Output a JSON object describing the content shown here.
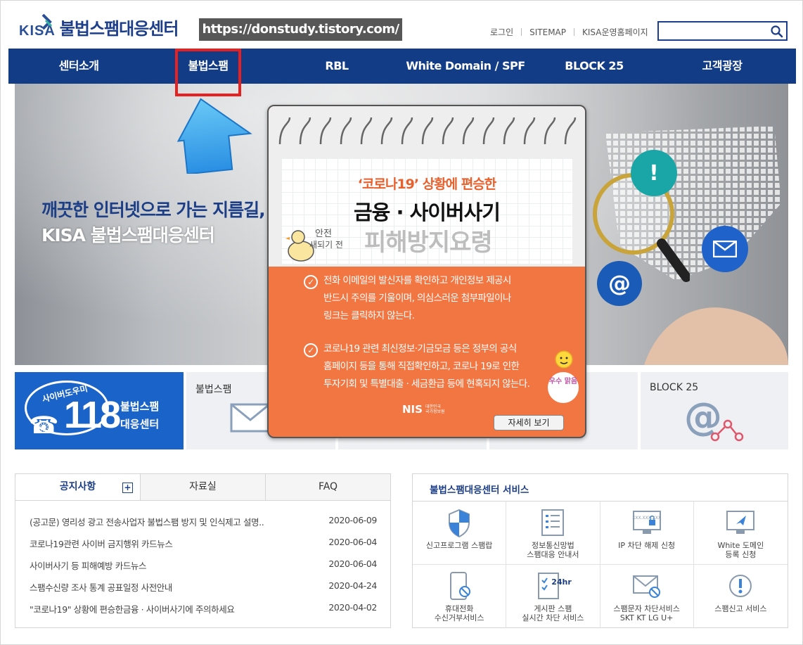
{
  "header": {
    "logo_mark": "KISA",
    "logo_title": "불법스팸대응센터",
    "url_banner": "https://donstudy.tistory.com/",
    "util_links": [
      "로그인",
      "SITEMAP",
      "KISA운영홈페이지"
    ],
    "search": {
      "value": "",
      "placeholder": ""
    }
  },
  "nav": {
    "items": [
      "센터소개",
      "불법스팸",
      "RBL",
      "White Domain / SPF",
      "BLOCK 25",
      "고객광장"
    ],
    "highlight_color": "#e8201f",
    "bar_color": "#133c86"
  },
  "hero": {
    "slogan_line1": "깨끗한 인터넷으로 가는 지름길,",
    "slogan_line2": "KISA 불법스팸대응센터"
  },
  "popup": {
    "subtitle": "‘코로나19’ 상황에 편승한",
    "headline": "금융 · 사이버사기",
    "headline2": "피해방지요령",
    "duck_text_1": "안전",
    "duck_text_2": "새되기 전",
    "items": [
      [
        "전화 이메일의 발신자를 확인하고 개인정보 제공시",
        "반드시 주의를 기울이며, 의심스러운 첨부파일이나",
        "링크는 클릭하지 않는다."
      ],
      [
        "코로나19 관련 최신정보·기금모금 등은 정부의 공식",
        "홈페이지 등을 통해 직접확인하고, 코로나 19로 인한",
        "투자기회 및 특별대출 · 세금환급 등에 현혹되지 않는다."
      ]
    ],
    "badge_text": "우수 맑음",
    "nis": "NIS",
    "nis_small_1": "대한민국",
    "nis_small_2": "국가정보원",
    "button": "자세히 보기",
    "accent": "#f17642"
  },
  "cards": {
    "card_118": {
      "tag": "사이버도우미",
      "number": "118",
      "line1": "불법스팸",
      "line2": "대응센터"
    },
    "titles": [
      "불법스팸",
      "",
      "",
      "BLOCK 25"
    ]
  },
  "notice": {
    "tabs": [
      "공지사항",
      "자료실",
      "FAQ"
    ],
    "plus": "+",
    "rows": [
      {
        "title": "(공고문) 영리성 광고 전송사업자 불법스팸 방지 및 인식제고 설명..",
        "date": "2020-06-09"
      },
      {
        "title": "코로나19관련 사이버 금지행위 카드뉴스",
        "date": "2020-06-04"
      },
      {
        "title": "사이버사기 등 피해예방 카드뉴스",
        "date": "2020-06-04"
      },
      {
        "title": "스팸수신량 조사 통계 공표일정 사전안내",
        "date": "2020-04-24"
      },
      {
        "title": "\"코로나19\" 상황에 편승한금융 · 사이버사기에 주의하세요",
        "date": "2020-04-02"
      }
    ]
  },
  "services": {
    "title": "불법스팸대응센터 서비스",
    "items": [
      {
        "label": "신고프로그램 스팸랍",
        "icon": "shield-icon"
      },
      {
        "label": "정보통신망법\n스팸대응 안내서",
        "icon": "document-list-icon"
      },
      {
        "label": "IP 차단 해제 신청",
        "icon": "ip-lock-icon"
      },
      {
        "label": "White 도메인\n등록 신청",
        "icon": "monitor-send-icon"
      },
      {
        "label": "휴대전화\n수신거부서비스",
        "icon": "phone-block-icon"
      },
      {
        "label": "게시판 스팸\n실시간 차단 서비스",
        "icon": "clipboard-24hr-icon"
      },
      {
        "label": "스팸문자 차단서비스\nSKT  KT  LG U+",
        "icon": "message-block-icon"
      },
      {
        "label": "스팸신고 서비스",
        "icon": "alert-icon"
      }
    ],
    "badge_24hr": "24hr",
    "ip_sample": "XXX.XXX.XXX"
  }
}
